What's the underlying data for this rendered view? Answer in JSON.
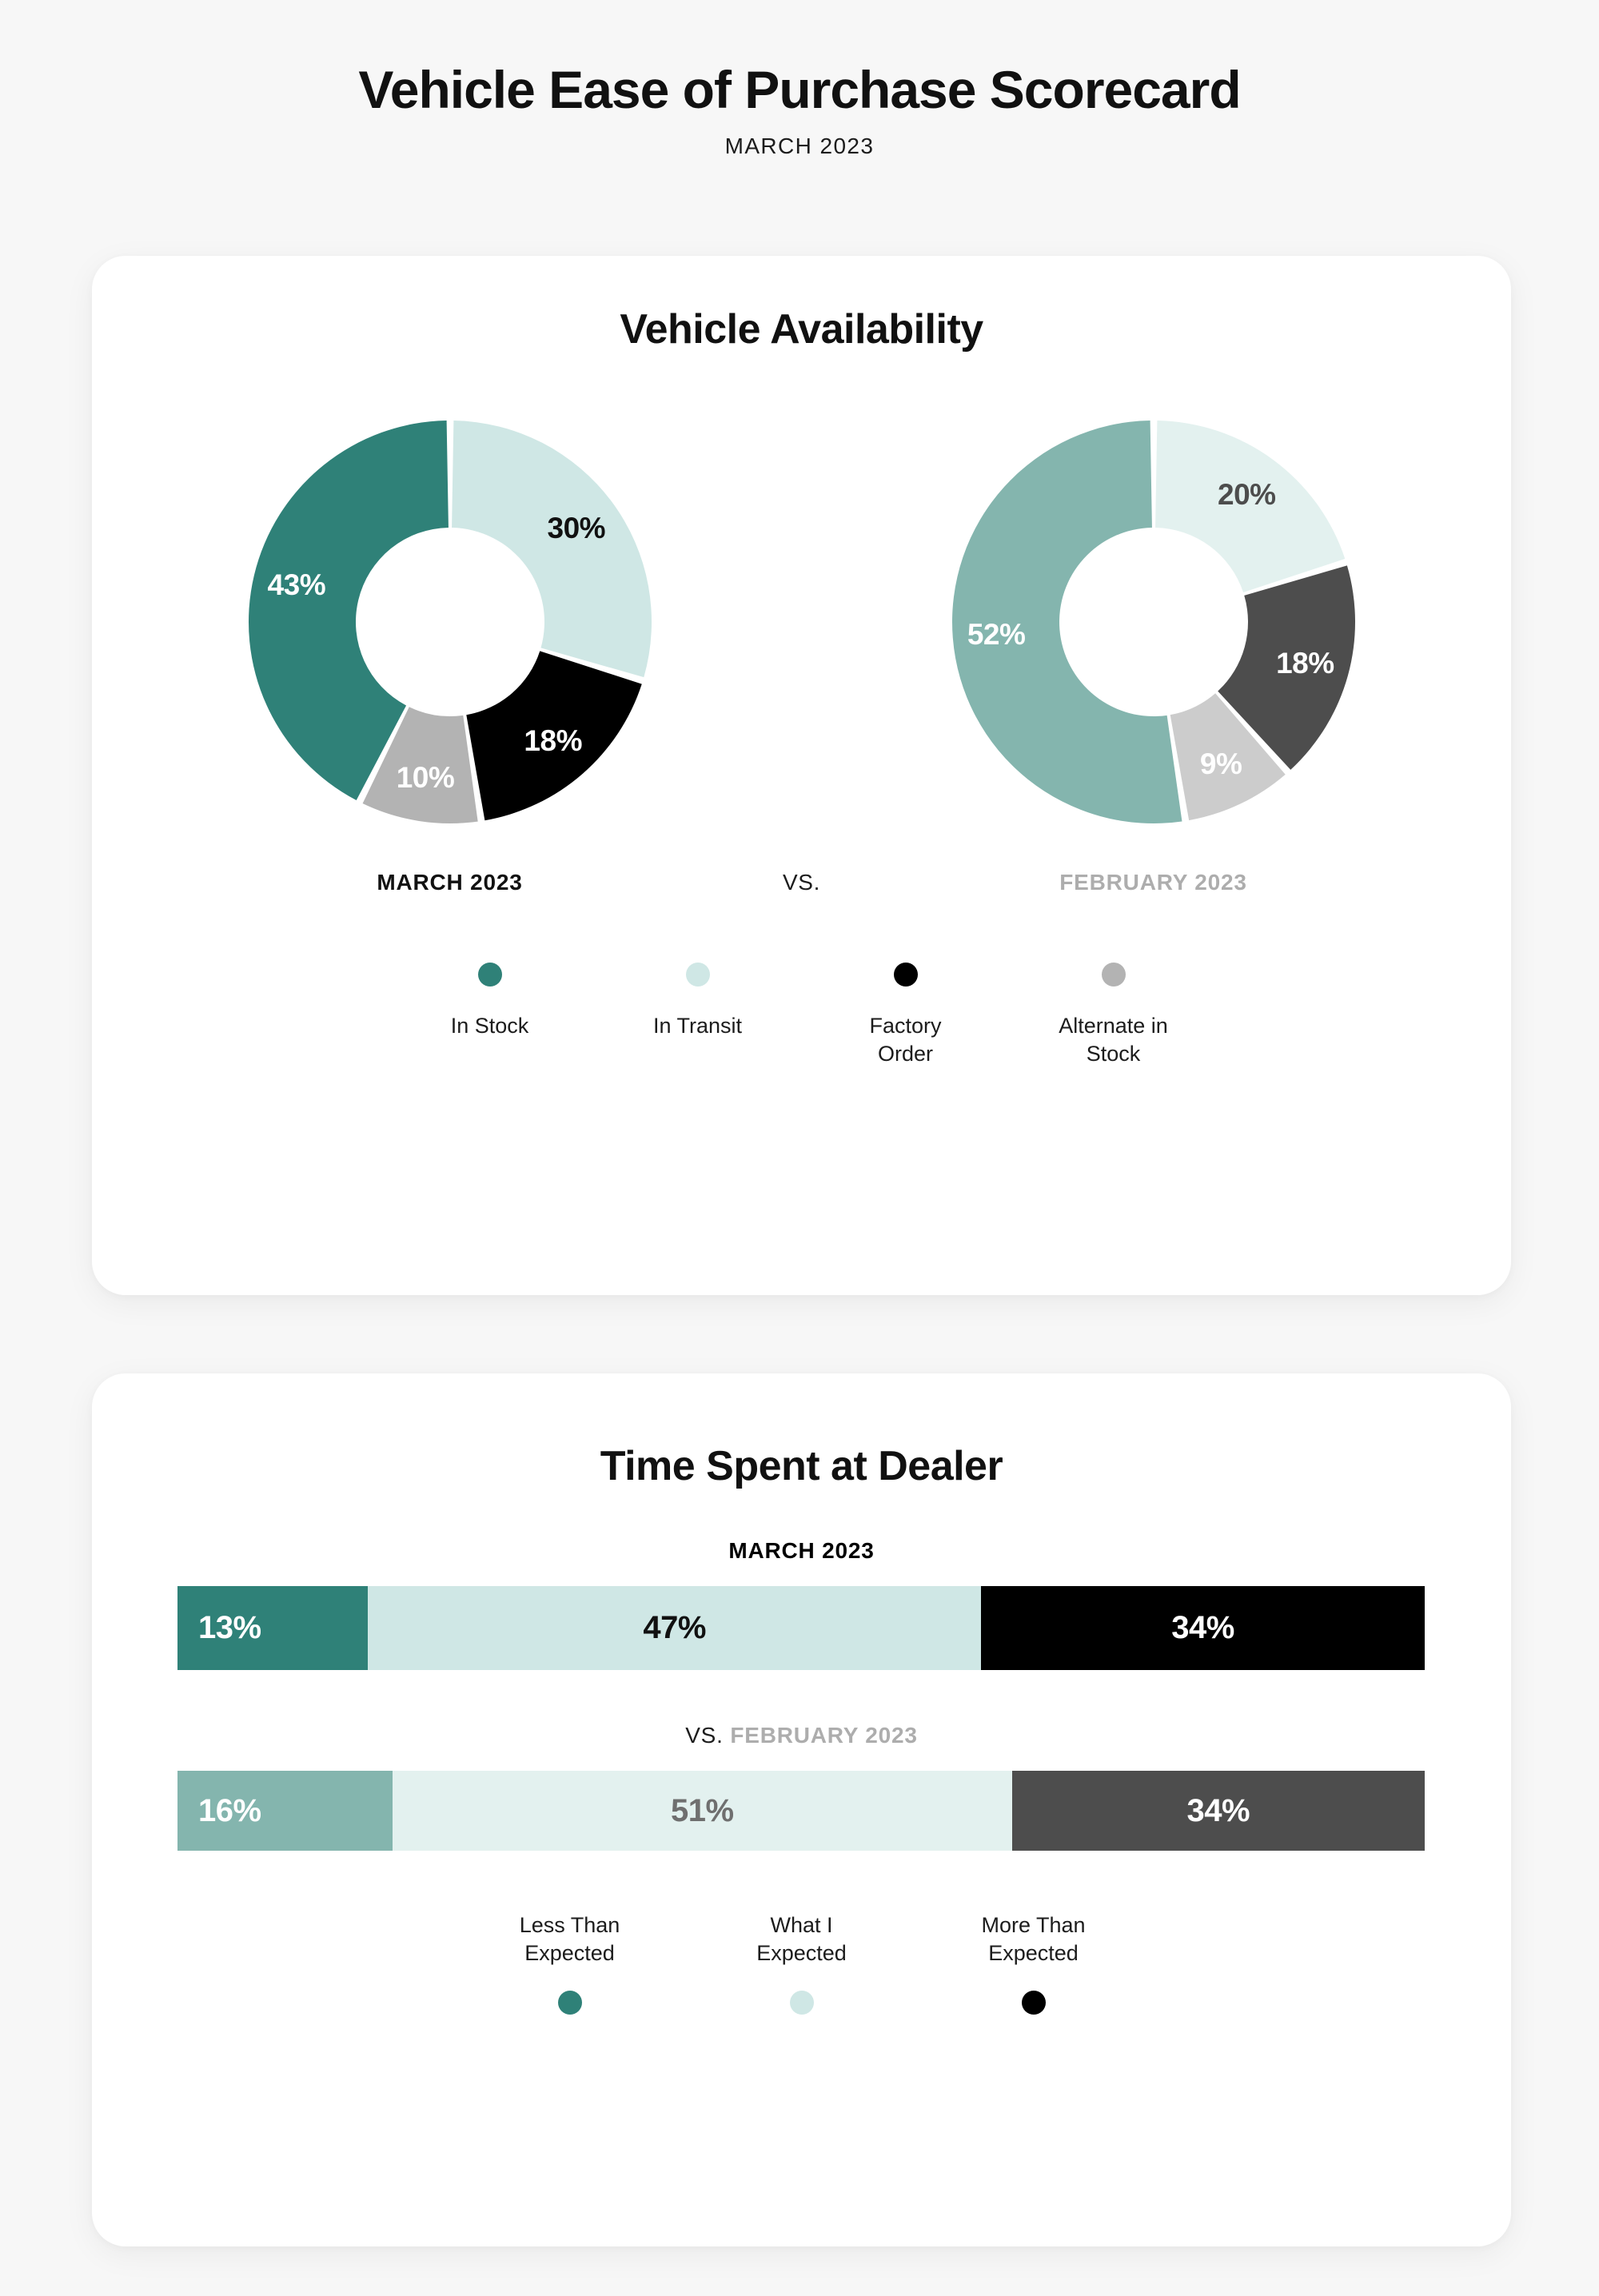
{
  "header": {
    "title": "Vehicle Ease of Purchase Scorecard",
    "subtitle": "MARCH 2023"
  },
  "colors": {
    "dark_teal": "#2f8178",
    "light_teal": "#cfe7e5",
    "black": "#000000",
    "gray": "#b3b3b3",
    "muted_teal": "#84b5ae",
    "pale_teal": "#e3f1ef",
    "dark_gray": "#4d4d4d",
    "light_gray": "#cccccc",
    "prev_label": "#adadad",
    "card_bg": "#ffffff",
    "page_bg": "#f7f7f7"
  },
  "availability": {
    "title": "Vehicle Availability",
    "current_label": "MARCH 2023",
    "vs_label": "VS.",
    "previous_label": "FEBRUARY 2023",
    "legend": [
      {
        "label": "In Stock",
        "color": "#2f8178",
        "dot": "legend-dot-in-stock"
      },
      {
        "label": "In Transit",
        "color": "#cfe7e5",
        "dot": "legend-dot-in-transit"
      },
      {
        "label": "Factory\nOrder",
        "color": "#000000",
        "dot": "legend-dot-factory-order"
      },
      {
        "label": "Alternate in\nStock",
        "color": "#b3b3b3",
        "dot": "legend-dot-alternate-in-stock"
      }
    ]
  },
  "time_at_dealer": {
    "title": "Time Spent at Dealer",
    "current_label": "MARCH 2023",
    "vs_label": "VS.",
    "previous_label": "FEBRUARY 2023",
    "legend": [
      {
        "label": "Less Than\nExpected",
        "color": "#2f8178"
      },
      {
        "label": "What I\nExpected",
        "color": "#cfe7e5"
      },
      {
        "label": "More Than\nExpected",
        "color": "#000000"
      }
    ]
  },
  "chart_data": [
    {
      "type": "pie",
      "title": "Vehicle Availability",
      "subtitle": "MARCH 2023",
      "labels": [
        "In Transit",
        "Factory Order",
        "Alternate in Stock",
        "In Stock"
      ],
      "values": [
        30,
        18,
        10,
        43
      ],
      "value_labels": [
        "30%",
        "18%",
        "10%",
        "43%"
      ],
      "colors": [
        "#cfe7e5",
        "#000000",
        "#b3b3b3",
        "#2f8178"
      ],
      "text_colors": [
        "#111111",
        "#ffffff",
        "#ffffff",
        "#ffffff"
      ],
      "start_angle": 0,
      "direction": "clockwise",
      "donut": true
    },
    {
      "type": "pie",
      "title": "Vehicle Availability",
      "subtitle": "FEBRUARY 2023",
      "labels": [
        "In Transit",
        "Factory Order",
        "Alternate in Stock",
        "In Stock"
      ],
      "values": [
        20,
        18,
        9,
        52
      ],
      "value_labels": [
        "20%",
        "18%",
        "9%",
        "52%"
      ],
      "colors": [
        "#e3f1ef",
        "#4d4d4d",
        "#cccccc",
        "#84b5ae"
      ],
      "text_colors": [
        "#4d4d4d",
        "#ffffff",
        "#ffffff",
        "#ffffff"
      ],
      "start_angle": 0,
      "direction": "clockwise",
      "donut": true
    },
    {
      "type": "bar",
      "orientation": "stacked-horizontal",
      "title": "Time Spent at Dealer",
      "subtitle": "MARCH 2023",
      "categories": [
        "Less Than Expected",
        "What I Expected",
        "More Than Expected"
      ],
      "values": [
        13,
        47,
        34
      ],
      "value_labels": [
        "13%",
        "47%",
        "34%"
      ],
      "colors": [
        "#2f8178",
        "#cfe7e5",
        "#000000"
      ],
      "text_colors": [
        "#ffffff",
        "#111111",
        "#ffffff"
      ]
    },
    {
      "type": "bar",
      "orientation": "stacked-horizontal",
      "title": "Time Spent at Dealer",
      "subtitle": "FEBRUARY 2023",
      "categories": [
        "Less Than Expected",
        "What I Expected",
        "More Than Expected"
      ],
      "values": [
        16,
        51,
        34
      ],
      "value_labels": [
        "16%",
        "51%",
        "34%"
      ],
      "colors": [
        "#84b5ae",
        "#e3f1ef",
        "#4d4d4d"
      ],
      "text_colors": [
        "#ffffff",
        "#6f6f6f",
        "#ffffff"
      ]
    }
  ]
}
